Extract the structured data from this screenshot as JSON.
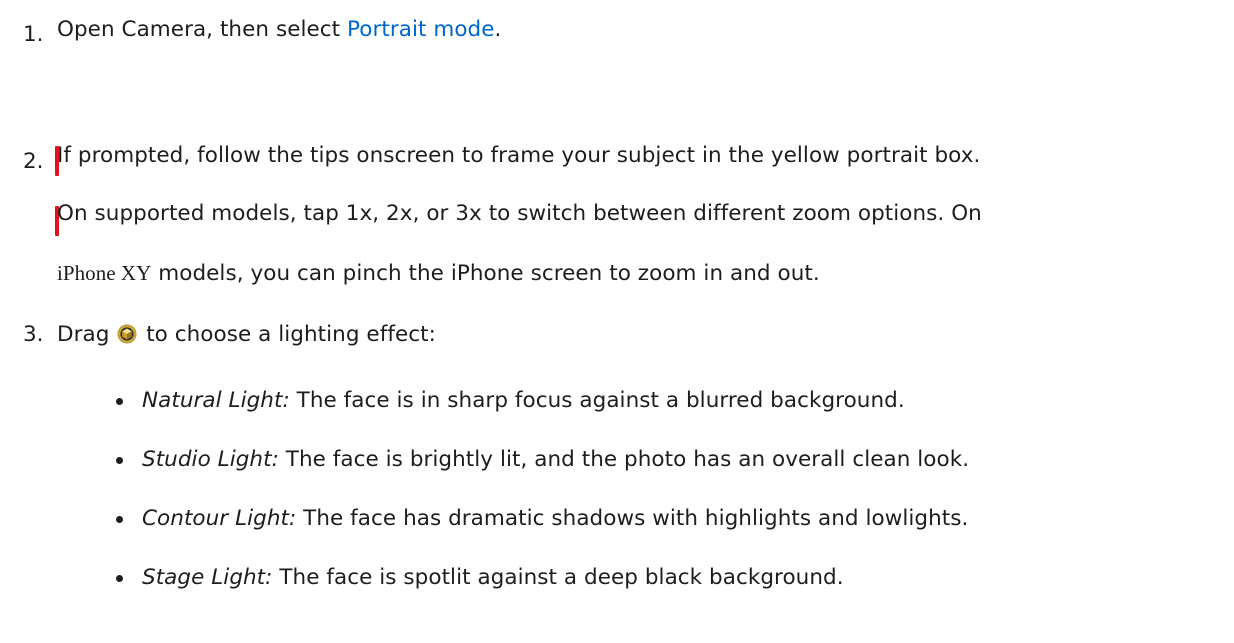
{
  "steps": [
    {
      "number": "1.",
      "text_before": "Open Camera, then select ",
      "link_text": "Portrait mode",
      "text_after": "."
    },
    {
      "number": "2.",
      "line1": "If prompted, follow the tips onscreen to frame your subject in the yellow portrait box.",
      "line2": "On supported models, tap 1x, 2x, or 3x to switch between different zoom options. On",
      "line3_model": "iPhone XY",
      "line3_rest": " models, you can pinch the iPhone screen to zoom in and out."
    },
    {
      "number": "3.",
      "text_before": "Drag ",
      "icon": "portrait-lighting-icon",
      "text_after": " to choose a lighting effect:"
    }
  ],
  "effects": [
    {
      "name": "Natural Light:",
      "description": " The face is in sharp focus against a blurred background."
    },
    {
      "name": "Studio Light:",
      "description": " The face is brightly lit, and the photo has an overall clean look."
    },
    {
      "name": "Contour Light:",
      "description": " The face has dramatic shadows with highlights and lowlights."
    },
    {
      "name": "Stage Light:",
      "description": " The face is spotlit against a deep black background."
    }
  ],
  "colors": {
    "text": "#1d1d1f",
    "link": "#0066cc",
    "cursor_marker": "#e2131f"
  }
}
